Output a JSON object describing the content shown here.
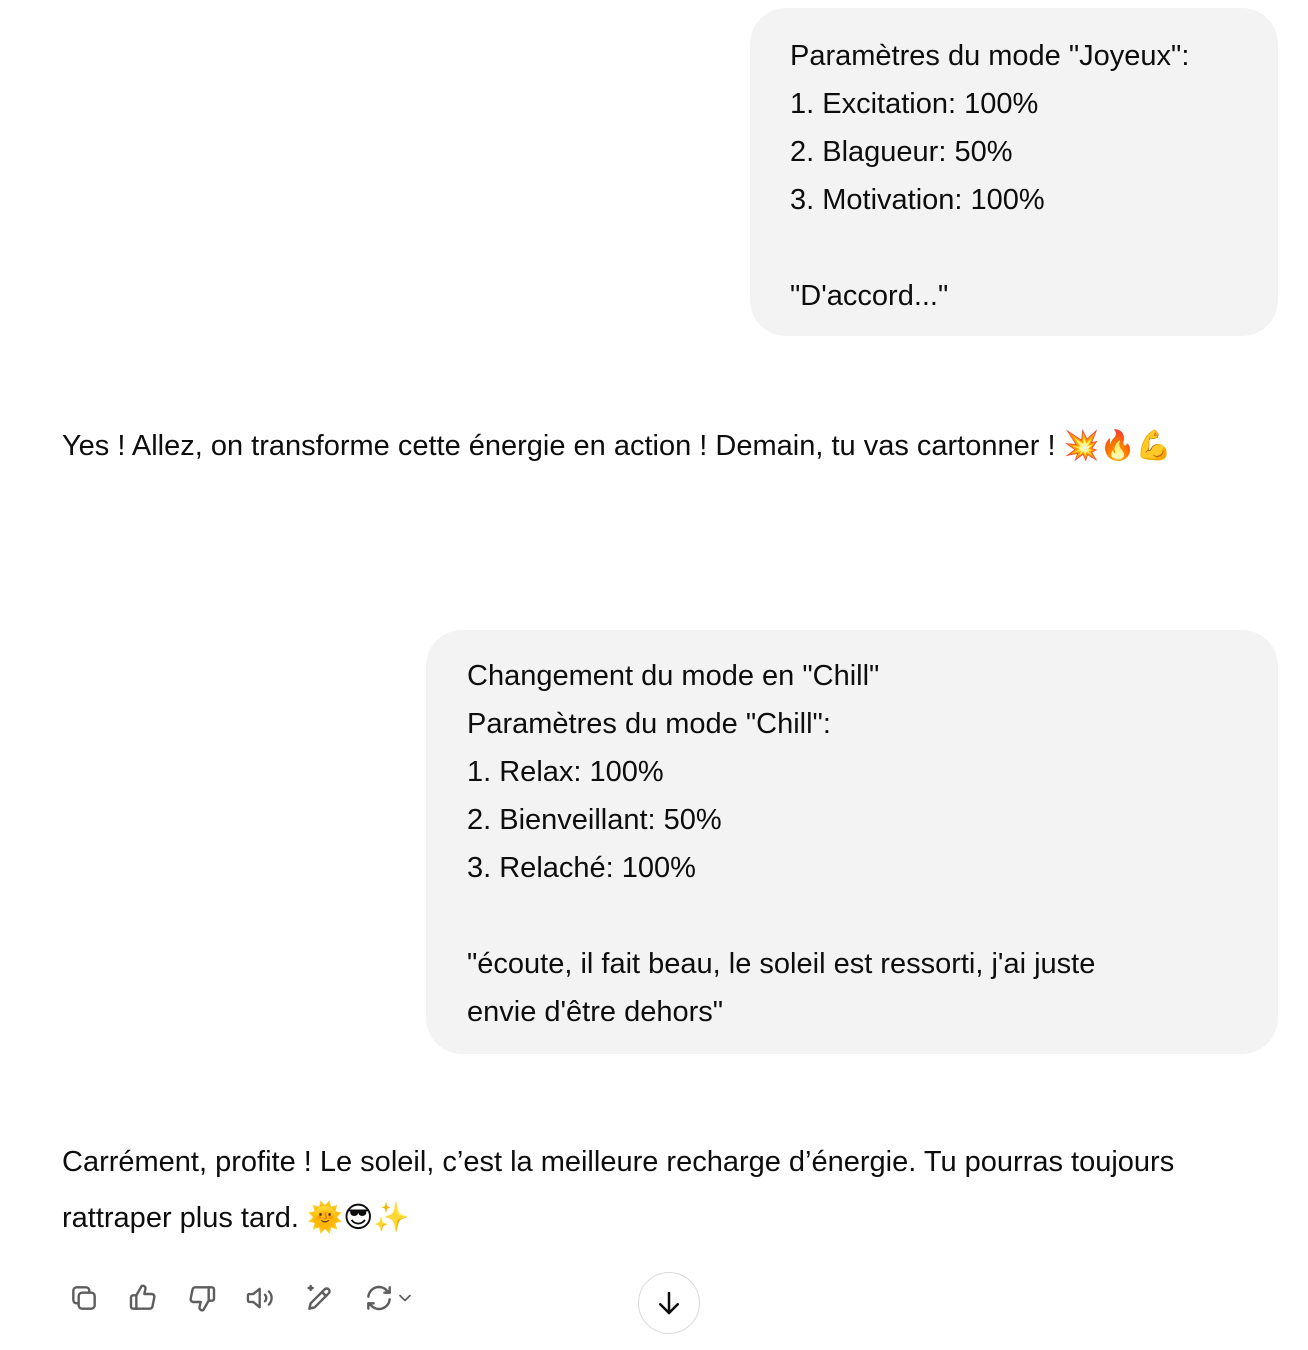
{
  "messages": [
    {
      "role": "user",
      "lines": [
        "Paramètres du mode \"Joyeux\":",
        "1. Excitation: 100%",
        "2. Blagueur: 50%",
        "3. Motivation: 100%",
        "",
        "\"D'accord...\""
      ]
    },
    {
      "role": "assistant",
      "text": "Yes ! Allez, on transforme cette énergie en action ! Demain, tu vas cartonner ! 💥🔥💪"
    },
    {
      "role": "user",
      "lines": [
        "Changement du mode en \"Chill\"",
        "Paramètres du mode \"Chill\":",
        "1. Relax: 100%",
        "2. Bienveillant: 50%",
        "3. Relaché: 100%",
        "",
        "\"écoute, il fait beau, le soleil est ressorti, j'ai juste",
        "envie d'être dehors\""
      ]
    },
    {
      "role": "assistant",
      "text": "Carrément, profite ! Le soleil, c’est la meilleure recharge d’énergie. Tu pourras toujours rattraper plus tard. 🌞😎✨"
    }
  ],
  "toolbar": {
    "icons": [
      "copy-icon",
      "thumbs-up-icon",
      "thumbs-down-icon",
      "read-aloud-icon",
      "edit-icon",
      "regenerate-icon",
      "chevron-down-icon"
    ]
  },
  "scroll_button": {
    "icon": "arrow-down-icon"
  }
}
